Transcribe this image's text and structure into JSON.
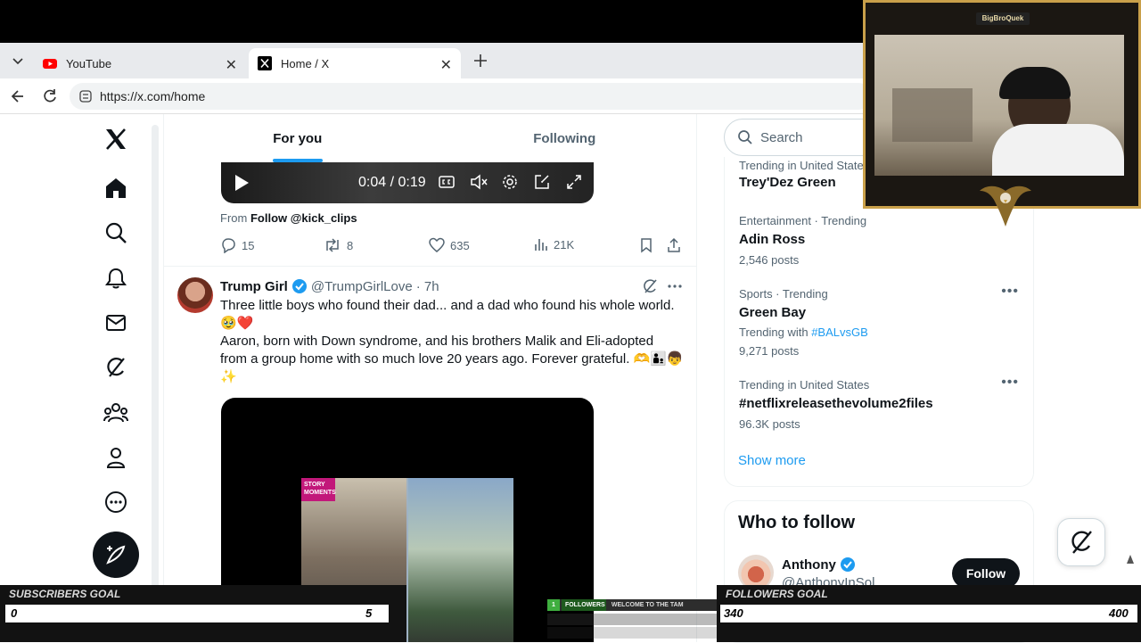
{
  "browser": {
    "tabs": [
      {
        "label": "YouTube",
        "active": false
      },
      {
        "label": "Home / X",
        "active": true
      }
    ],
    "url": "https://x.com/home"
  },
  "timeline": {
    "tabs": [
      {
        "label": "For you",
        "active": true
      },
      {
        "label": "Following",
        "active": false
      }
    ],
    "video": {
      "time": "0:04 / 0:19"
    },
    "from_prefix": "From",
    "from_link": "Follow @kick_clips",
    "prev_actions": {
      "replies": "15",
      "reposts": "8",
      "likes": "635",
      "views": "21K"
    },
    "tweet": {
      "name": "Trump Girl",
      "handle": "@TrumpGirlLove",
      "time": "· 7h",
      "line1": "Three little boys who found their dad... and a dad who found his whole world. 🥹❤️",
      "line2": "Aaron, born with Down syndrome, and his brothers Malik and Eli-adopted from a group home with so much love 20 years ago. Forever grateful. 🫶🧑‍🧒👦✨",
      "media_badge": "STORY MOMENTS"
    }
  },
  "sidebar": {
    "search_placeholder": "Search",
    "trends": [
      {
        "meta": "Trending in United States",
        "title": "Trey'Dez Green",
        "count": ""
      },
      {
        "meta": "Entertainment · Trending",
        "title": "Adin Ross",
        "count": "2,546 posts"
      },
      {
        "meta": "Sports · Trending",
        "title": "Green Bay",
        "with_prefix": "Trending with",
        "with_tag": "#BALvsGB",
        "count": "9,271 posts"
      },
      {
        "meta": "Trending in United States",
        "title": "#netflixreleasethevolume2files",
        "count": "96.3K posts"
      }
    ],
    "show_more": "Show more",
    "who_to_follow": {
      "title": "Who to follow",
      "name": "Anthony",
      "handle": "@AnthonyInSol",
      "button": "Follow"
    }
  },
  "overlay": {
    "cam_label": "BigBroQuek",
    "subscribers_goal": {
      "title": "SUBSCRIBERS GOAL",
      "current": "0",
      "target": "5"
    },
    "followers_goal": {
      "title": "FOLLOWERS GOAL",
      "current": "340",
      "target": "400"
    },
    "ticker": {
      "rank": "1",
      "label": "FOLLOWERS",
      "message": "WELCOME TO THE TAM"
    }
  },
  "colors": {
    "accent": "#1d9bf0",
    "text": "#0f1419",
    "muted": "#536471",
    "goal_gold": "#c9a04a"
  }
}
